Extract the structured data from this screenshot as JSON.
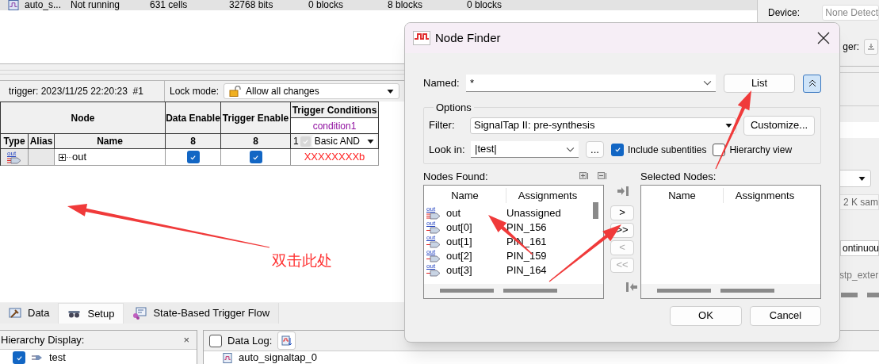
{
  "instance_row": {
    "name": "auto_s...",
    "status": "Not running",
    "cells": "631 cells",
    "bits": "32768 bits",
    "blocks": [
      "0 blocks",
      "8 blocks",
      "0 blocks"
    ]
  },
  "device_panel": {
    "device_label": "Device:",
    "device_value": "None Detect",
    "trigger_label": "ger:",
    "sample_depth": "2 K sam",
    "mode": "ontinuou",
    "clock": "stp_exter"
  },
  "trigger_bar": {
    "title": "trigger: 2023/11/25 22:20:23  #1",
    "lock_label": "Lock mode:",
    "lock_value": "Allow all changes"
  },
  "node_table": {
    "group_header": "Node",
    "columns": [
      "Type",
      "Alias",
      "Name"
    ],
    "data_enable": {
      "title": "Data Enable",
      "count": "8"
    },
    "trigger_enable": {
      "title": "Trigger Enable",
      "count": "8"
    },
    "trigger_conditions": {
      "title": "Trigger Conditions",
      "condition": "condition1",
      "index": "1",
      "checked": true,
      "mode": "Basic AND"
    },
    "rows": [
      {
        "icon_label": "out",
        "name": "out",
        "data_enabled": true,
        "trigger_enabled": true,
        "value": "XXXXXXXXb"
      }
    ]
  },
  "annotation": {
    "text": "双击此处"
  },
  "tabs": [
    {
      "label": "Data",
      "selected": false
    },
    {
      "label": "Setup",
      "selected": true
    },
    {
      "label": "State-Based Trigger Flow",
      "selected": false
    }
  ],
  "hierarchy_panel": {
    "title": "Hierarchy Display:",
    "close": "×",
    "items": [
      {
        "label": "test",
        "checked": true
      }
    ]
  },
  "data_log": {
    "label": "Data Log:",
    "checked": false,
    "instance": "auto_signaltap_0"
  },
  "dialog": {
    "title": "Node Finder",
    "named": {
      "label": "Named:",
      "value": "*"
    },
    "list_button": "List",
    "options_label": "Options",
    "filter": {
      "label": "Filter:",
      "value": "SignalTap II: pre-synthesis"
    },
    "customize_button": "Customize...",
    "look_in": {
      "label": "Look in:",
      "value": "|test|"
    },
    "browse_button": "...",
    "include_subentities": {
      "label": "Include subentities",
      "checked": true
    },
    "hierarchy_view": {
      "label": "Hierarchy view",
      "checked": false
    },
    "nodes_found": {
      "title": "Nodes Found:",
      "columns": [
        "Name",
        "Assignments"
      ],
      "rows": [
        {
          "kind": "bus",
          "icon_label": "out",
          "name": "out",
          "assignment": "Unassigned"
        },
        {
          "kind": "pin",
          "icon_label": "out",
          "name": "out[0]",
          "assignment": "PIN_156"
        },
        {
          "kind": "pin",
          "icon_label": "out",
          "name": "out[1]",
          "assignment": "PIN_161"
        },
        {
          "kind": "pin",
          "icon_label": "out",
          "name": "out[2]",
          "assignment": "PIN_159"
        },
        {
          "kind": "pin",
          "icon_label": "out",
          "name": "out[3]",
          "assignment": "PIN_164"
        }
      ]
    },
    "transfer_buttons": [
      {
        "label": ">",
        "disabled": false
      },
      {
        "label": ">>",
        "disabled": false
      },
      {
        "label": "<",
        "disabled": true
      },
      {
        "label": "<<",
        "disabled": true
      }
    ],
    "selected_nodes": {
      "title": "Selected Nodes:",
      "columns": [
        "Name",
        "Assignments"
      ]
    },
    "buttons": [
      "OK",
      "Cancel"
    ]
  }
}
